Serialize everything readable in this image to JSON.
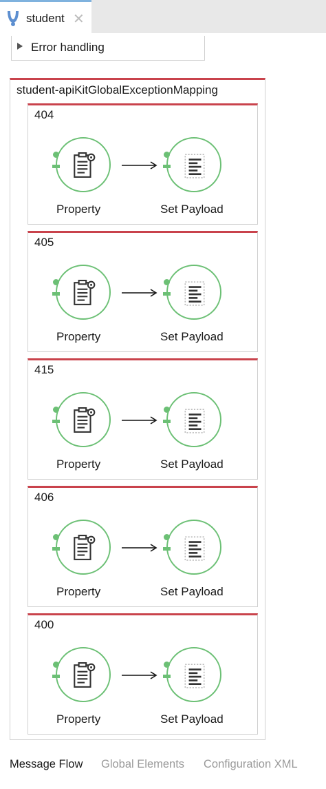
{
  "tab": {
    "label": "student"
  },
  "error_handling": {
    "label": "Error handling"
  },
  "mapping": {
    "title": "student-apiKitGlobalExceptionMapping",
    "cases": [
      {
        "code": "404",
        "nodes": [
          "Property",
          "Set Payload"
        ]
      },
      {
        "code": "405",
        "nodes": [
          "Property",
          "Set Payload"
        ]
      },
      {
        "code": "415",
        "nodes": [
          "Property",
          "Set Payload"
        ]
      },
      {
        "code": "406",
        "nodes": [
          "Property",
          "Set Payload"
        ]
      },
      {
        "code": "400",
        "nodes": [
          "Property",
          "Set Payload"
        ]
      }
    ]
  },
  "bottom_tabs": [
    {
      "label": "Message Flow",
      "active": true
    },
    {
      "label": "Global Elements",
      "active": false
    },
    {
      "label": "Configuration XML",
      "active": false
    }
  ],
  "colors": {
    "accent_red": "#c9434c",
    "node_green": "#6cc075",
    "tab_blue": "#7fb2de"
  }
}
